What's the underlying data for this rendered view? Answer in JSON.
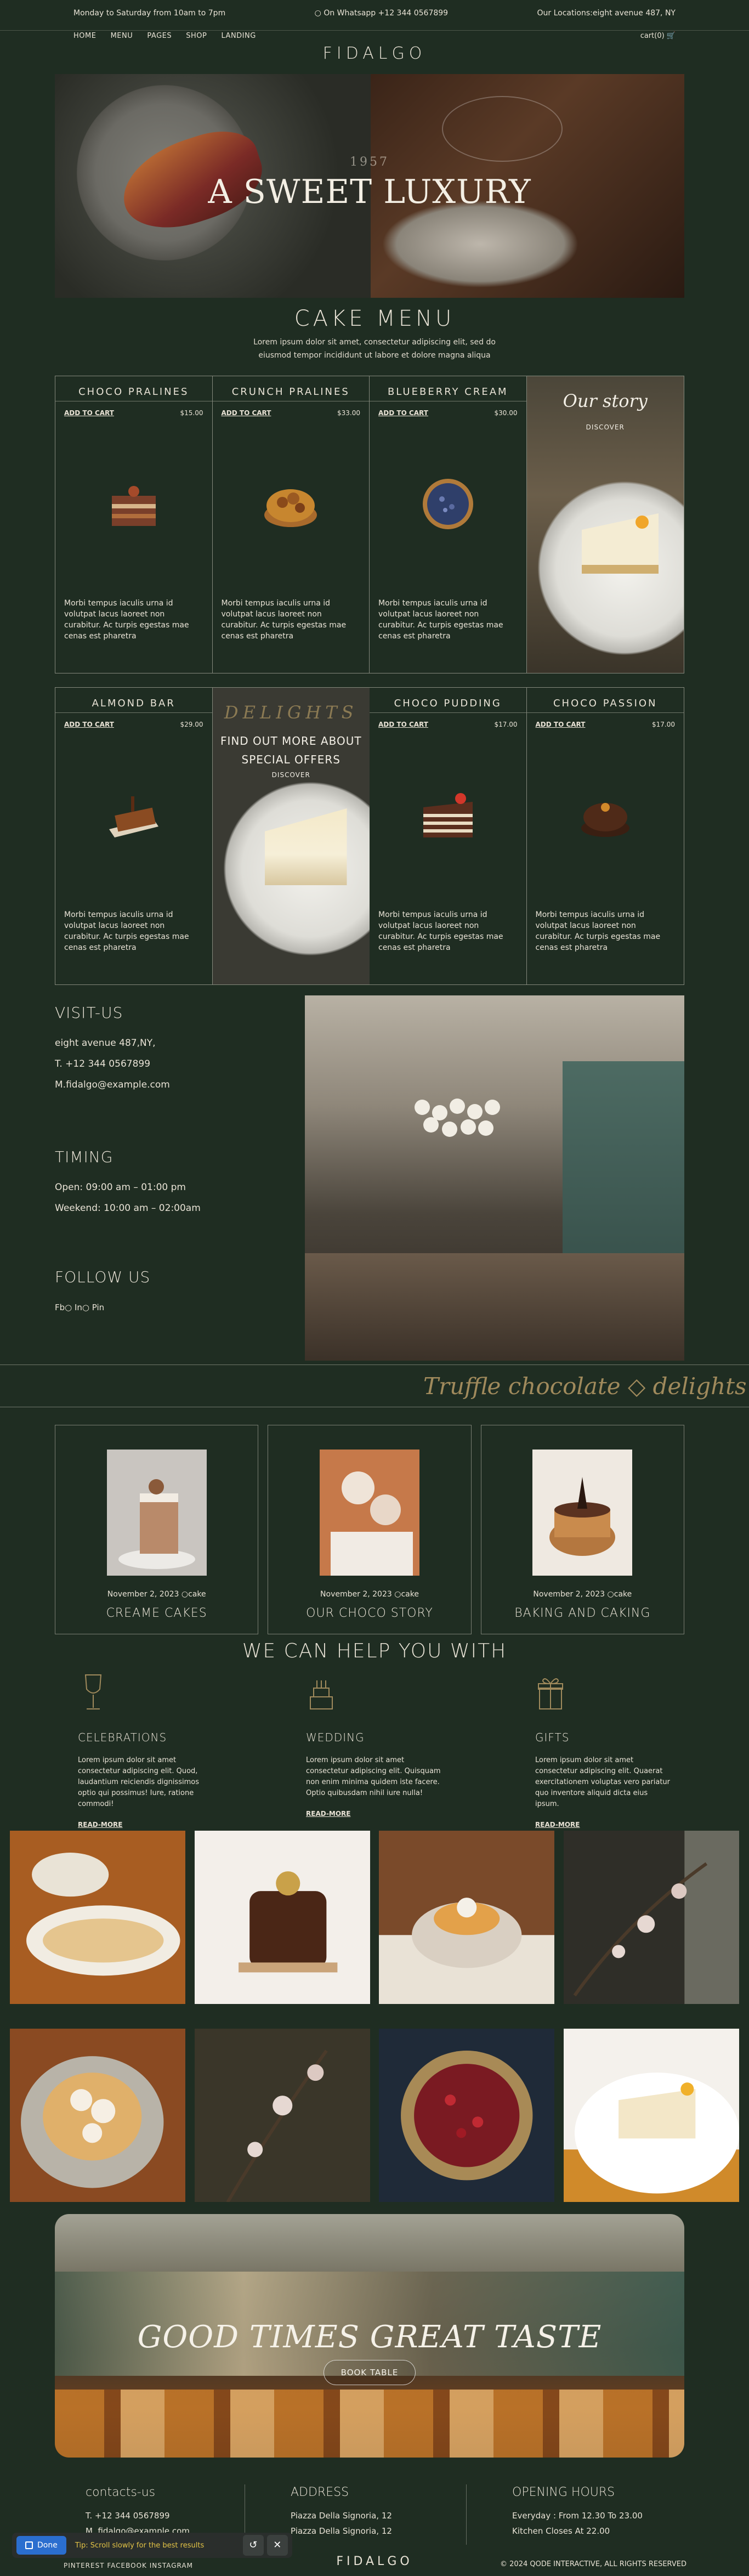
{
  "topbar": {
    "hours": "Monday to Saturday from 10am to 7pm",
    "whatsapp": "On Whatsapp +12 344 0567899",
    "locations": "Our Locations:eight avenue 487, NY",
    "menu": [
      "HOME",
      "MENU",
      "PAGES",
      "SHOP",
      "LANDING"
    ],
    "cart": "cart(0)"
  },
  "logo": "FIDALGO",
  "hero": {
    "small": "1957",
    "title": "A SWEET LUXURY"
  },
  "cake_menu": {
    "title": "CAKE MENU",
    "subtitle_1": "Lorem ipsum dolor sit amet, consectetur adipiscing elit, sed do",
    "subtitle_2": "eiusmod tempor incididunt ut labore et dolore magna aliqua",
    "add_to_cart": "ADD TO CART",
    "desc": "Morbi tempus iaculis urna id volutpat lacus laoreet non curabitur. Ac turpis egestas mae cenas est pharetra",
    "row1": [
      {
        "name": "CHOCO PRALINES",
        "price": "$15.00"
      },
      {
        "name": "CRUNCH PRALINES",
        "price": "$33.00"
      },
      {
        "name": "BLUEBERRY CREAM",
        "price": "$30.00"
      }
    ],
    "our_story": {
      "title": "Our story",
      "cta": "DISCOVER"
    },
    "row2_first": {
      "name": "ALMOND BAR",
      "price": "$29.00"
    },
    "promo": {
      "script": "DELIGHTS",
      "title_line1": "FIND OUT MORE ABOUT",
      "title_line2": "SPECIAL OFFERS",
      "cta": "DISCOVER"
    },
    "row2_rest": [
      {
        "name": "CHOCO PUDDING",
        "price": "$17.00"
      },
      {
        "name": "CHOCO PASSION",
        "price": "$17.00"
      }
    ]
  },
  "visit": {
    "title": "VISIT-US",
    "address": "eight avenue 487,NY,",
    "phone": "T. +12 344 0567899",
    "email": "M.fidalgo@example.com",
    "timing_title": "TIMING",
    "open": "Open: 09:00 am – 01:00 pm",
    "weekend": "Weekend: 10:00 am – 02:00am",
    "follow_title": "FOLLOW US",
    "socials": "Fb○ In○ Pin"
  },
  "marquee": "Truffle chocolate ◇ delights ◇ wedding cakes ◇ p",
  "posts": [
    {
      "date": "November 2, 2023",
      "cat": "cake",
      "title": "CREAME CAKES"
    },
    {
      "date": "November 2, 2023",
      "cat": "cake",
      "title": "OUR CHOCO STORY"
    },
    {
      "date": "November 2, 2023",
      "cat": "cake",
      "title": "BAKING AND CAKING"
    }
  ],
  "help": {
    "title": "WE CAN HELP YOU WITH",
    "read_more": "READ-MORE",
    "cols": [
      {
        "title": "CELEBRATIONS",
        "text": "Lorem ipsum dolor sit amet consectetur adipiscing elit. Quod, laudantium reiciendis dignissimos optio qui possimus! Iure, ratione commodi!"
      },
      {
        "title": "WEDDING",
        "text": "Lorem ipsum dolor sit amet consectetur adipiscing elit. Quisquam non enim minima quidem iste facere. Optio quibusdam nihil iure nulla!"
      },
      {
        "title": "GIFTS",
        "text": "Lorem ipsum dolor sit amet consectetur adipiscing elit. Quaerat exercitationem voluptas vero pariatur quo inventore aliquid dicta eius ipsum."
      }
    ]
  },
  "cta": {
    "title": "GOOD TIMES GREAT TASTE",
    "button": "BOOK TABLE"
  },
  "footer": {
    "contacts_title": "contacts-us",
    "phone": "T. +12 344 0567899",
    "email": "M. fidalgo@example.com",
    "address_title": "ADDRESS",
    "address_1": "Piazza Della Signoria, 12",
    "address_2": "Piazza Della Signoria, 12",
    "hours_title": "OPENING HOURS",
    "hours_1": "Everyday : From 12.30 To 23.00",
    "hours_2": "Kitchen Closes At 22.00",
    "socials": "PINTEREST    FACEBOOK    INSTAGRAM",
    "logo": "FIDALGO",
    "copyright": "© 2024 QODE INTERACTIVE, ALL RIGHTS RESERVED"
  },
  "dock": {
    "done": "Done",
    "tip": "Tip: Scroll slowly for the best results"
  },
  "colors": {
    "background": "#1f2d22",
    "text": "#e9e3d6",
    "accent_gold": "#a08a5c",
    "done_blue": "#2b6ecf",
    "tip_yellow": "#e4c446"
  }
}
